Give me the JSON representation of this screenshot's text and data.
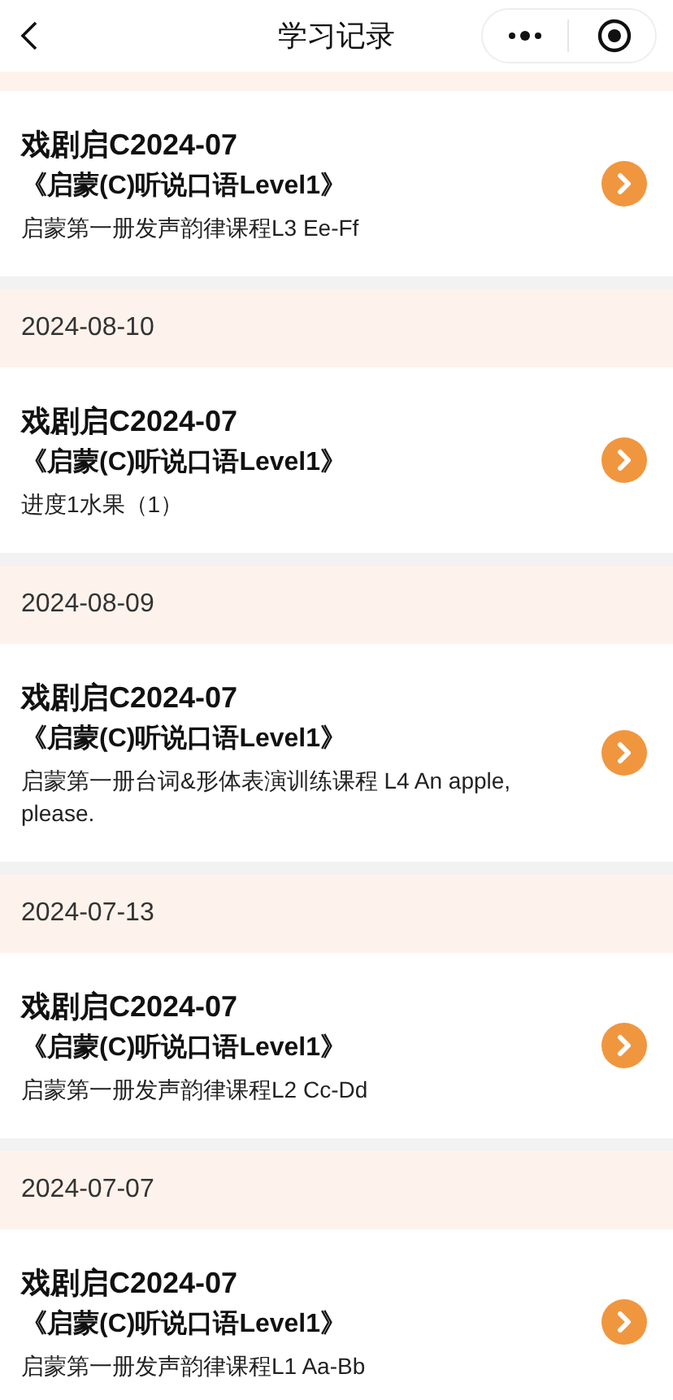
{
  "header": {
    "title": "学习记录"
  },
  "groups": [
    {
      "records": [
        {
          "title": "戏剧启C2024-07",
          "course": "《启蒙(C)听说口语Level1》",
          "lesson": "启蒙第一册发声韵律课程L3 Ee-Ff"
        }
      ]
    },
    {
      "date": "2024-08-10",
      "records": [
        {
          "title": "戏剧启C2024-07",
          "course": "《启蒙(C)听说口语Level1》",
          "lesson": "进度1水果（1）"
        }
      ]
    },
    {
      "date": "2024-08-09",
      "records": [
        {
          "title": "戏剧启C2024-07",
          "course": "《启蒙(C)听说口语Level1》",
          "lesson": "启蒙第一册台词&形体表演训练课程 L4 An apple, please."
        }
      ]
    },
    {
      "date": "2024-07-13",
      "records": [
        {
          "title": "戏剧启C2024-07",
          "course": "《启蒙(C)听说口语Level1》",
          "lesson": "启蒙第一册发声韵律课程L2 Cc-Dd"
        }
      ]
    },
    {
      "date": "2024-07-07",
      "records": [
        {
          "title": "戏剧启C2024-07",
          "course": "《启蒙(C)听说口语Level1》",
          "lesson": "启蒙第一册发声韵律课程L1 Aa-Bb"
        }
      ]
    }
  ]
}
